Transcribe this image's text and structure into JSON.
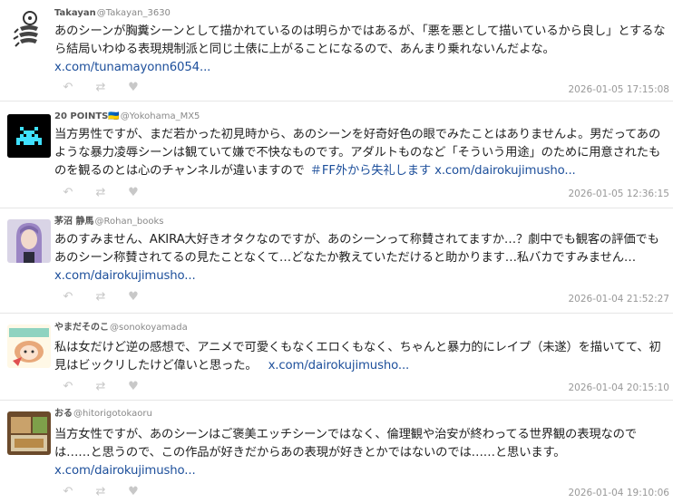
{
  "tweets": [
    {
      "name": "Takayan",
      "handle": "@Takayan_3630",
      "text": "あのシーンが胸糞シーンとして描かれているのは明らかではあるが、「悪を悪として描いているから良し」とするなら結局いわゆる表現規制派と同じ土俵に上がることになるので、あんまり乗れないんだよな。",
      "link": "x.com/tunamayonn6054...",
      "hashtag": "",
      "time": "2026-01-05 17:15:08"
    },
    {
      "name": "20 POINTS🇺🇦",
      "handle": "@Yokohama_MX5",
      "text": "当方男性ですが、まだ若かった初見時から、あのシーンを好奇好色の眼でみたことはありませんよ。男だってあのような暴力凌辱シーンは観ていて嫌で不快なものです。アダルトものなど「そういう用途」のために用意されたものを観るのとは心のチャンネルが違いますので",
      "hashtag": "＃FF外から失礼します",
      "link": "x.com/dairokujimusho...",
      "time": "2026-01-05 12:36:15"
    },
    {
      "name": "茅沼 静馬",
      "handle": "@Rohan_books",
      "text": "あのすみません、AKIRA大好きオタクなのですが、あのシーンって称賛されてますか…？劇中でも観客の評価でもあのシーン称賛されてるの見たことなくて…どなたか教えていただけると助かります…私バカですみません…",
      "hashtag": "",
      "link": "x.com/dairokujimusho...",
      "time": "2026-01-04 21:52:27"
    },
    {
      "name": "やまだそのこ",
      "handle": "@sonokoyamada",
      "text": "私は女だけど逆の感想で、アニメで可愛くもなくエロくもなく、ちゃんと暴力的にレイプ（未遂）を描いてて、初見はビックリしたけど偉いと思った。",
      "hashtag": "",
      "link": "x.com/dairokujimusho...",
      "time": "2026-01-04 20:15:10"
    },
    {
      "name": "おる",
      "handle": "@hitorigotokaoru",
      "text": "当方女性ですが、あのシーンはご褒美エッチシーンではなく、倫理観や治安が終わってる世界観の表現なのでは……と思うので、この作品が好きだからあの表現が好きとかではないのでは……と思います。",
      "hashtag": "",
      "link": "x.com/dairokujimusho...",
      "time": "2026-01-04 19:10:06"
    }
  ],
  "icons": [
    "reply-icon",
    "retweet-icon",
    "like-icon"
  ],
  "colors": {
    "link": "#1d4f9b",
    "meta": "#999999",
    "divider": "#e6e6e6"
  }
}
